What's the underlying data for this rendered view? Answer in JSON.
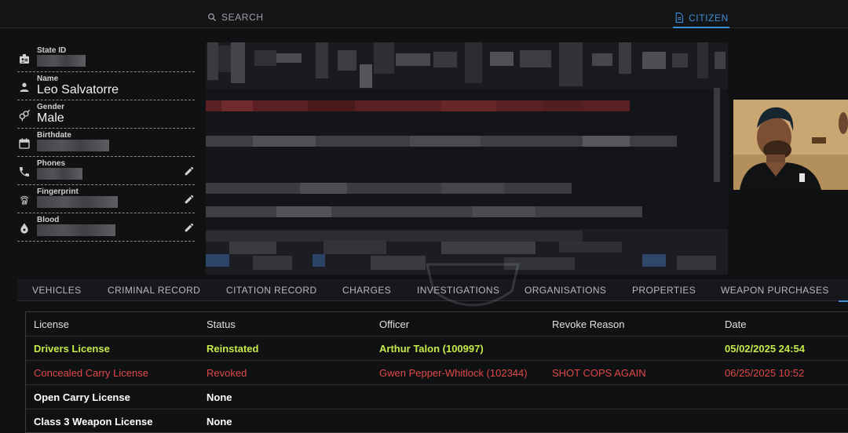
{
  "nav": {
    "search_label": "SEARCH",
    "citizen_label": "CITIZEN",
    "accent_color": "#3f8fd8"
  },
  "profile": {
    "fields": [
      {
        "label": "State ID",
        "value": "",
        "icon": "id-badge-icon",
        "redacted": true,
        "editable": false
      },
      {
        "label": "Name",
        "value": "Leo Salvatorre",
        "icon": "person-icon",
        "redacted": false,
        "editable": false
      },
      {
        "label": "Gender",
        "value": "Male",
        "icon": "gender-icon",
        "redacted": false,
        "editable": false
      },
      {
        "label": "Birthdate",
        "value": "",
        "icon": "calendar-icon",
        "redacted": true,
        "editable": false
      },
      {
        "label": "Phones",
        "value": "",
        "icon": "phone-icon",
        "redacted": true,
        "editable": true
      },
      {
        "label": "Fingerprint",
        "value": "",
        "icon": "fingerprint-icon",
        "redacted": true,
        "editable": true
      },
      {
        "label": "Blood",
        "value": "",
        "icon": "blood-drop-icon",
        "redacted": true,
        "editable": true
      }
    ]
  },
  "tabs": [
    {
      "label": "VEHICLES"
    },
    {
      "label": "CRIMINAL RECORD"
    },
    {
      "label": "CITATION RECORD"
    },
    {
      "label": "CHARGES"
    },
    {
      "label": "INVESTIGATIONS"
    },
    {
      "label": "ORGANISATIONS"
    },
    {
      "label": "PROPERTIES"
    },
    {
      "label": "WEAPON PURCHASES"
    }
  ],
  "licenses": {
    "columns": [
      "License",
      "Status",
      "Officer",
      "Revoke Reason",
      "Date"
    ],
    "rows": [
      {
        "license": "Drivers License",
        "status": "Reinstated",
        "officer": "Arthur Talon (100997)",
        "reason": "",
        "date": "05/02/2025 24:54",
        "tone": "green"
      },
      {
        "license": "Concealed Carry License",
        "status": "Revoked",
        "officer": "Gwen Pepper-Whitlock (102344)",
        "reason": "SHOT COPS AGAIN",
        "date": "06/25/2025 10:52",
        "tone": "red"
      },
      {
        "license": "Open Carry License",
        "status": "None",
        "officer": "",
        "reason": "",
        "date": "",
        "tone": "white"
      },
      {
        "license": "Class 3 Weapon License",
        "status": "None",
        "officer": "",
        "reason": "",
        "date": "",
        "tone": "white"
      }
    ],
    "colors": {
      "green": "#c9e84a",
      "red": "#e04848",
      "white": "#ffffff"
    }
  }
}
